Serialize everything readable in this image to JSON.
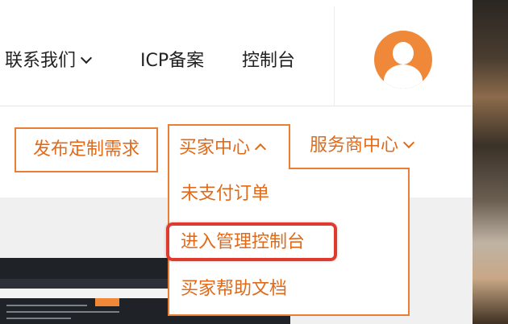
{
  "nav": {
    "contact_label": "联系我们",
    "icp_label": "ICP备案",
    "console_label": "控制台"
  },
  "menu": {
    "publish_label": "发布定制需求",
    "buyer_center_label": "买家中心",
    "vendor_center_label": "服务商中心"
  },
  "dropdown": {
    "items": [
      {
        "label": "未支付订单"
      },
      {
        "label": "进入管理控制台"
      },
      {
        "label": "买家帮助文档"
      }
    ]
  },
  "colors": {
    "accent": "#e87f35",
    "text_accent": "#e06a1a",
    "highlight": "#e03a2e"
  },
  "icons": {
    "avatar": "user-avatar-icon",
    "dropdown_open": "chevron-up-icon",
    "dropdown_closed": "chevron-down-icon"
  }
}
